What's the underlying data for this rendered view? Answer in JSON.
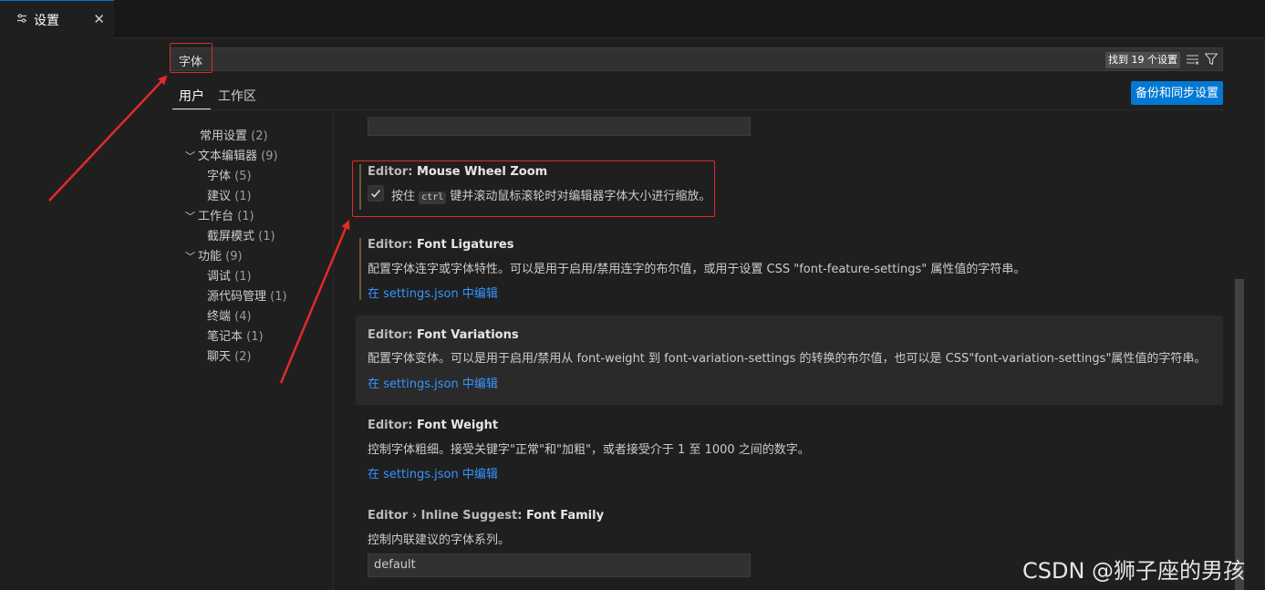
{
  "tab": {
    "icon": "settings-sliders-icon",
    "label": "设置"
  },
  "search": {
    "value": "字体",
    "result_badge": "找到 19 个设置"
  },
  "scope": {
    "user": "用户",
    "workspace": "工作区"
  },
  "sync_button": "备份和同步设置",
  "toc": {
    "items": [
      {
        "label": "常用设置",
        "count": "(2)"
      },
      {
        "label": "文本编辑器",
        "count": "(9)"
      },
      {
        "label": "字体",
        "count": "(5)"
      },
      {
        "label": "建议",
        "count": "(1)"
      },
      {
        "label": "工作台",
        "count": "(1)"
      },
      {
        "label": "截屏模式",
        "count": "(1)"
      },
      {
        "label": "功能",
        "count": "(9)"
      },
      {
        "label": "调试",
        "count": "(1)"
      },
      {
        "label": "源代码管理",
        "count": "(1)"
      },
      {
        "label": "终端",
        "count": "(4)"
      },
      {
        "label": "笔记本",
        "count": "(1)"
      },
      {
        "label": "聊天",
        "count": "(2)"
      }
    ]
  },
  "settings": {
    "mouse_wheel_zoom": {
      "category": "Editor: ",
      "name": "Mouse Wheel Zoom",
      "desc_before": "按住",
      "key": "ctrl",
      "desc_after": "键并滚动鼠标滚轮时对编辑器字体大小进行缩放。",
      "checked": true
    },
    "font_ligatures": {
      "category": "Editor: ",
      "name": "Font Ligatures",
      "desc": "配置字体连字或字体特性。可以是用于启用/禁用连字的布尔值，或用于设置 CSS \"font-feature-settings\" 属性值的字符串。",
      "link": "在 settings.json 中编辑"
    },
    "font_variations": {
      "category": "Editor: ",
      "name": "Font Variations",
      "desc": "配置字体变体。可以是用于启用/禁用从 font-weight 到 font-variation-settings 的转换的布尔值，也可以是 CSS\"font-variation-settings\"属性值的字符串。",
      "link": "在 settings.json 中编辑"
    },
    "font_weight": {
      "category": "Editor: ",
      "name": "Font Weight",
      "desc": "控制字体粗细。接受关键字\"正常\"和\"加粗\"，或者接受介于 1 至 1000 之间的数字。",
      "link": "在 settings.json 中编辑"
    },
    "inline_suggest_font_family": {
      "category": "Editor › Inline Suggest: ",
      "name": "Font Family",
      "desc": "控制内联建议的字体系列。",
      "value": "default"
    }
  },
  "watermark": "CSDN @狮子座的男孩",
  "colors": {
    "accent": "#0078d4",
    "link": "#3794ff",
    "annotation": "#e02b27"
  }
}
